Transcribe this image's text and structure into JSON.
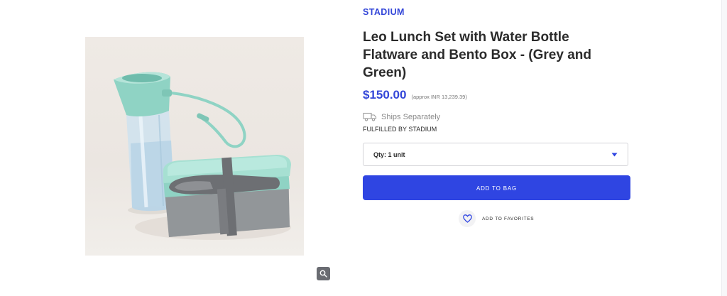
{
  "product": {
    "brand": "STADIUM",
    "title": "Leo Lunch Set with Water Bottle Flatware and Bento Box - (Grey and Green)",
    "price": "$150.00",
    "approx_price": "(approx INR 13,239.39)",
    "image_alt": "Leo Lunch Set with Water Bottle Flatware and Bento Box"
  },
  "shipping": {
    "ships_text": "Ships Separately",
    "fulfilled_text": "FULFILLED BY STADIUM",
    "icon": "truck-icon"
  },
  "quantity": {
    "selected": "Qty: 1 unit",
    "icon": "caret-down-icon"
  },
  "actions": {
    "add_to_bag": "ADD TO BAG",
    "add_to_favorites": "ADD TO FAVORITES",
    "favorite_icon": "heart-icon",
    "zoom_icon": "magnifier-icon"
  },
  "colors": {
    "brand_blue": "#3346d8",
    "button_blue": "#2f45e2",
    "product_teal": "#8fd3c4",
    "product_grey": "#8e9194"
  }
}
